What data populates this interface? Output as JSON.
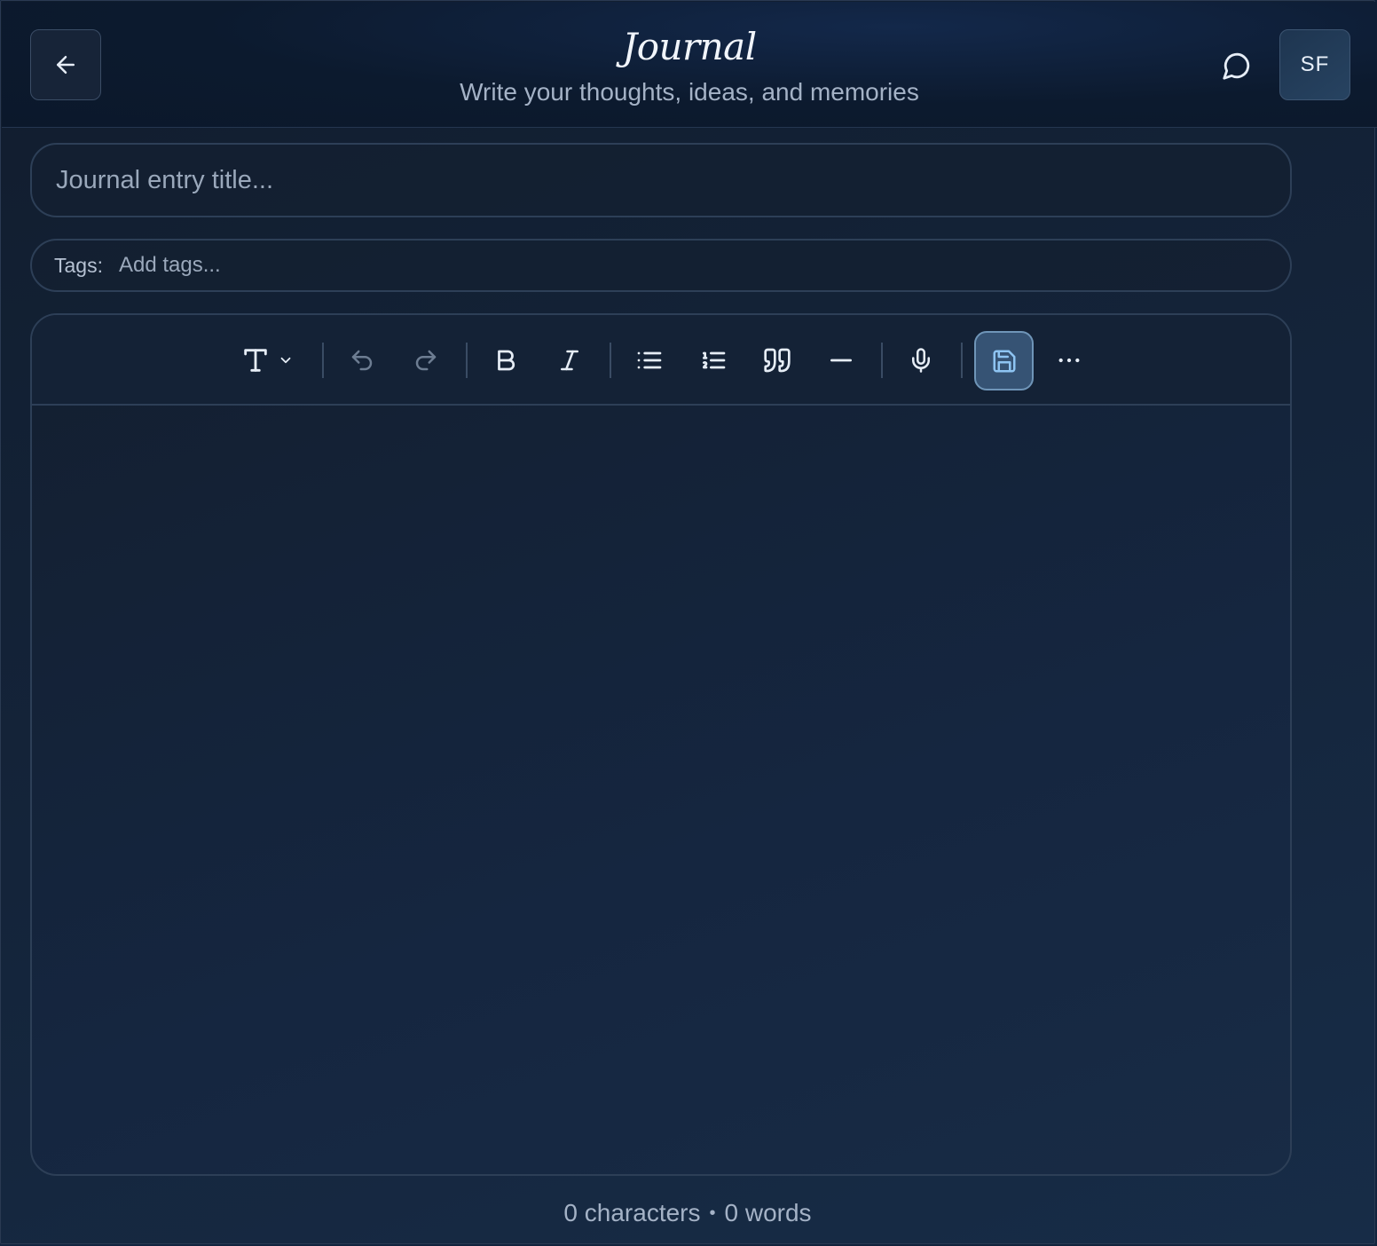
{
  "header": {
    "title": "Journal",
    "subtitle": "Write your thoughts, ideas, and memories",
    "back_icon": "arrow-left-icon",
    "chat_icon": "message-circle-icon",
    "avatar_initials": "SF"
  },
  "entry": {
    "title_placeholder": "Journal entry title...",
    "tags_label": "Tags:",
    "tags_placeholder": "Add tags..."
  },
  "toolbar": {
    "items": [
      "text-style-icon",
      "undo-icon",
      "redo-icon",
      "bold-icon",
      "italic-icon",
      "bullet-list-icon",
      "numbered-list-icon",
      "quote-icon",
      "horizontal-rule-icon",
      "microphone-icon",
      "save-icon",
      "more-icon"
    ]
  },
  "footer": {
    "characters": "0 characters",
    "separator": "•",
    "words": "0 words"
  },
  "colors": {
    "background": "#111d2e",
    "accent_save": "#365374",
    "text_primary": "#f1f5fb",
    "text_muted": "#a4b2c6"
  }
}
